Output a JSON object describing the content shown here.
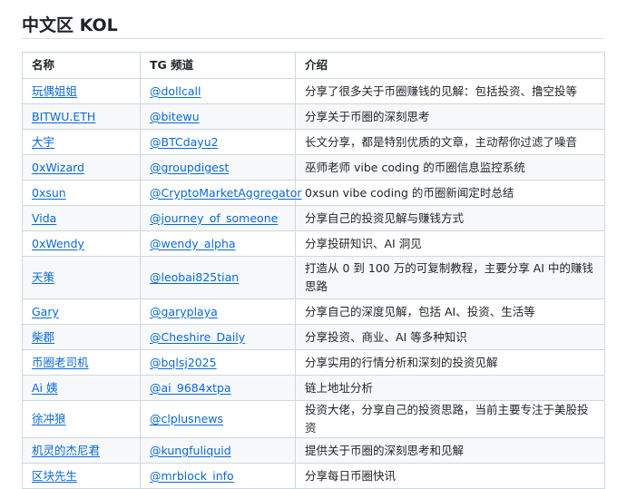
{
  "heading": "中文区 KOL",
  "table": {
    "headers": [
      "名称",
      "TG 频道",
      "介绍"
    ],
    "rows": [
      {
        "name": "玩偶姐姐",
        "channel": "@dollcall",
        "intro": "分享了很多关于币圈赚钱的见解：包括投资、撸空投等"
      },
      {
        "name": "BITWU.ETH",
        "channel": "@bitewu",
        "intro": "分享关于币圈的深刻思考"
      },
      {
        "name": "大宇",
        "channel": "@BTCdayu2",
        "intro": "长文分享，都是特别优质的文章，主动帮你过滤了噪音"
      },
      {
        "name": "0xWizard",
        "channel": "@groupdigest",
        "intro": "巫师老师 vibe coding 的币圈信息监控系统"
      },
      {
        "name": "0xsun",
        "channel": "@CryptoMarketAggregator",
        "intro": "0xsun vibe coding 的币圈新闻定时总结"
      },
      {
        "name": "Vida",
        "channel": "@journey_of_someone",
        "intro": "分享自己的投资见解与赚钱方式"
      },
      {
        "name": "0xWendy",
        "channel": "@wendy_alpha",
        "intro": "分享投研知识、AI 洞见"
      },
      {
        "name": "天策",
        "channel": "@leobai825tian",
        "intro": "打造从 0 到 100 万的可复制教程，主要分享 AI 中的赚钱思路"
      },
      {
        "name": "Gary",
        "channel": "@garyplaya",
        "intro": "分享自己的深度见解，包括 AI、投资、生活等"
      },
      {
        "name": "柴郡",
        "channel": "@Cheshire_Daily",
        "intro": "分享投资、商业、AI 等多种知识"
      },
      {
        "name": "币圈老司机",
        "channel": "@bqlsj2025",
        "intro": "分享实用的行情分析和深刻的投资见解"
      },
      {
        "name": "Ai 姨",
        "channel": "@ai_9684xtpa",
        "intro": "链上地址分析"
      },
      {
        "name": "徐冲狼",
        "channel": "@clplusnews",
        "intro": "投资大佬，分享自己的投资思路，当前主要专注于美股投资"
      },
      {
        "name": "机灵的杰尼君",
        "channel": "@kungfuliquid",
        "intro": "提供关于币圈的深刻思考和见解"
      },
      {
        "name": "区块先生",
        "channel": "@mrblock_info",
        "intro": "分享每日币圈快讯"
      }
    ]
  },
  "colors": {
    "link": "#0969da",
    "border": "#d0d7de",
    "stripe": "#f6f8fa"
  }
}
